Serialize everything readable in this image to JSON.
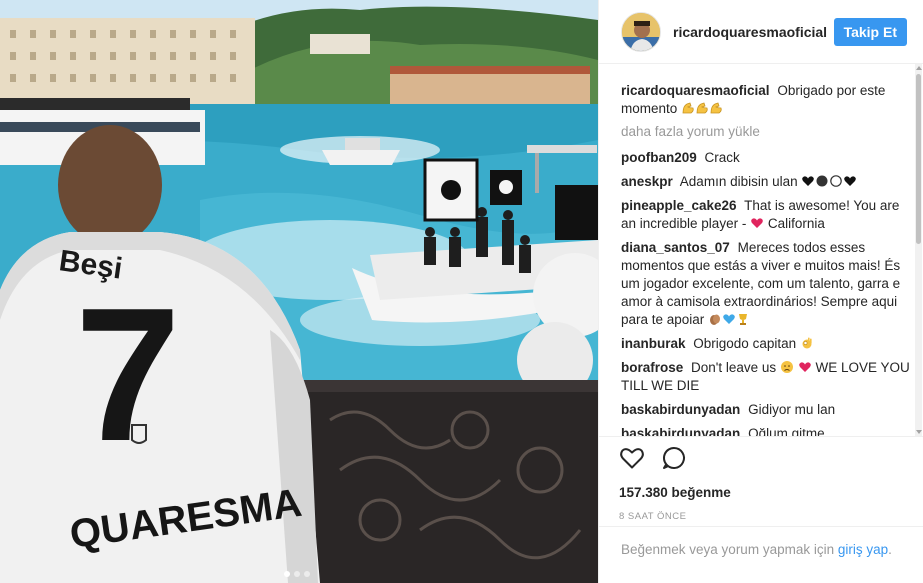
{
  "post": {
    "photo_number_text": "7",
    "photo_name_text": "QUARESMA",
    "photo_sponsor_text": "Beşi",
    "carousel": {
      "total": 3,
      "active_index": 0
    }
  },
  "header": {
    "username": "ricardoquaresmaoficial",
    "follow_label": "Takip Et",
    "avatar_icon": "profile-photo"
  },
  "caption": {
    "username": "ricardoquaresmaoficial",
    "text": "Obrigado por este momento"
  },
  "load_more": "daha fazla yorum yükle",
  "comments": [
    {
      "username": "poofban209",
      "text": "Crack"
    },
    {
      "username": "aneskpr",
      "text": "Adamın dibisin ulan"
    },
    {
      "username": "pineapple_cake26",
      "text": "That is awesome! You are an incredible player -",
      "text_after": "California"
    },
    {
      "username": "diana_santos_07",
      "text": "Mereces todos esses momentos que estás a viver e muitos mais! És um jogador excelente, com um talento, garra e amor à camisola extraordinários! Sempre aqui para te apoiar"
    },
    {
      "username": "inanburak",
      "text": "Obrigodo capitan"
    },
    {
      "username": "borafrose",
      "text": "Don't leave us",
      "text_after": "WE LOVE YOU TILL WE DIE"
    },
    {
      "username": "baskabirdunyadan",
      "text": "Gidiyor mu lan"
    },
    {
      "username": "baskabirdunyadan",
      "text": "Oğlum gitme"
    }
  ],
  "actions": {
    "like_icon": "heart-outline",
    "comment_icon": "speech-bubble"
  },
  "likes": "157.380 beğenme",
  "time_ago": "8 SAAT ÖNCE",
  "login": {
    "prefix": "Beğenmek veya yorum yapmak için",
    "link": "giriş yap",
    "suffix": "."
  },
  "colors": {
    "accent": "#3897f0",
    "text": "#262626",
    "muted": "#999999",
    "emoji_yellow": "#f5c242",
    "heart_red": "#e0245e"
  }
}
